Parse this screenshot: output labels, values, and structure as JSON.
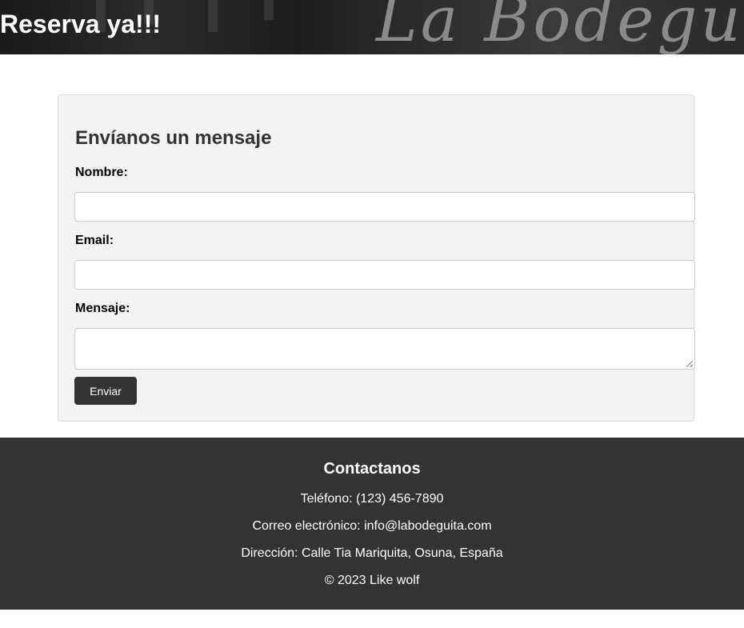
{
  "header": {
    "title": "Reserva ya!!!",
    "logo_text": "La Bodeguita"
  },
  "form": {
    "heading": "Envíanos un mensaje",
    "fields": [
      {
        "label": "Nombre:",
        "value": "",
        "placeholder": ""
      },
      {
        "label": "Email:",
        "value": "",
        "placeholder": ""
      },
      {
        "label": "Mensaje:",
        "value": "",
        "placeholder": ""
      }
    ],
    "submit_label": "Enviar"
  },
  "footer": {
    "heading": "Contactanos",
    "phone": "Teléfono: (123) 456-7890",
    "email": "Correo electrónico: info@labodeguita.com",
    "address": "Dirección: Calle Tia Mariquita, Osuna, España",
    "copyright": "© 2023 Like wolf"
  },
  "colors": {
    "footer_bg": "#333333",
    "card_bg": "#f3f3f3",
    "button_bg": "#333333"
  }
}
